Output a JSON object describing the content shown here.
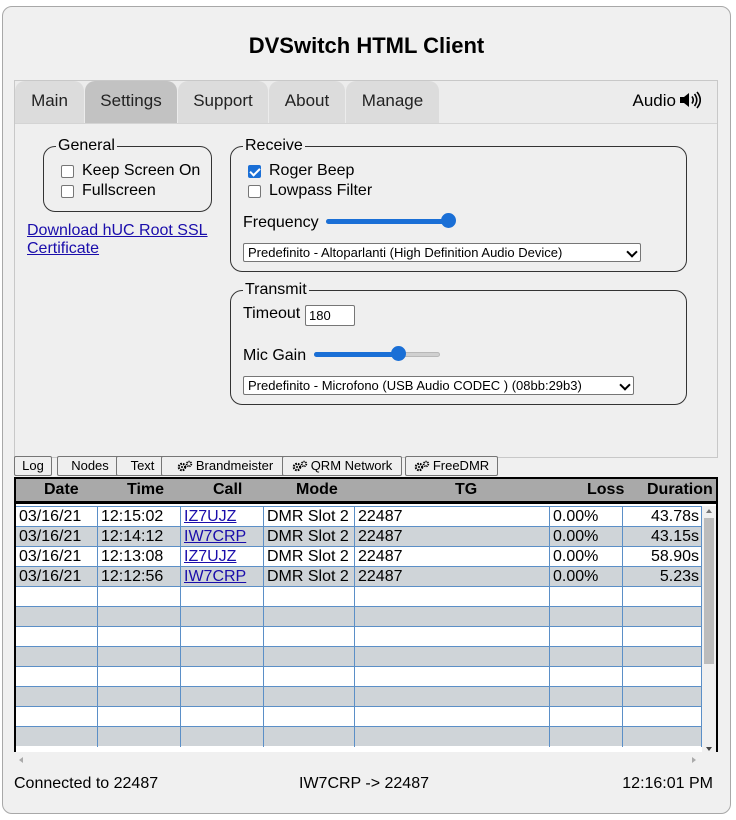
{
  "window": {
    "title": "DVSwitch HTML Client"
  },
  "tabs": [
    {
      "label": "Main",
      "active": false
    },
    {
      "label": "Settings",
      "active": true
    },
    {
      "label": "Support",
      "active": false
    },
    {
      "label": "About",
      "active": false
    },
    {
      "label": "Manage",
      "active": false
    }
  ],
  "audio": {
    "label": "Audio",
    "icon": "speaker-icon"
  },
  "general": {
    "legend": "General",
    "keep_screen_on": {
      "label": "Keep Screen On",
      "checked": false
    },
    "fullscreen": {
      "label": "Fullscreen",
      "checked": false
    }
  },
  "cert_link": "Download hUC Root SSL Certificate",
  "receive": {
    "legend": "Receive",
    "roger_beep": {
      "label": "Roger Beep",
      "checked": true
    },
    "lowpass": {
      "label": "Lowpass Filter",
      "checked": false
    },
    "frequency_label": "Frequency",
    "frequency_level": 1.0,
    "output_device": "Predefinito - Altoparlanti (High Definition Audio Device)"
  },
  "transmit": {
    "legend": "Transmit",
    "timeout_label": "Timeout",
    "timeout_value": "180",
    "mic_gain_label": "Mic Gain",
    "mic_gain_level": 0.68,
    "input_device": "Predefinito - Microfono (USB Audio CODEC ) (08bb:29b3)"
  },
  "log_buttons": [
    {
      "label": "Log",
      "icon": ""
    },
    {
      "label": "Nodes",
      "icon": ""
    },
    {
      "label": "Text",
      "icon": ""
    },
    {
      "label": "Brandmeister",
      "icon": "gears-icon"
    },
    {
      "label": "QRM Network",
      "icon": "gears-icon"
    },
    {
      "label": "FreeDMR",
      "icon": "gears-icon"
    }
  ],
  "table": {
    "columns": [
      "Date",
      "Time",
      "Call",
      "Mode",
      "TG",
      "Loss",
      "Duration"
    ],
    "rows": [
      [
        "03/16/21",
        "12:15:02",
        "IZ7UJZ",
        "DMR Slot 2",
        "22487",
        "0.00%",
        "43.78s"
      ],
      [
        "03/16/21",
        "12:14:12",
        "IW7CRP",
        "DMR Slot 2",
        "22487",
        "0.00%",
        "43.15s"
      ],
      [
        "03/16/21",
        "12:13:08",
        "IZ7UJZ",
        "DMR Slot 2",
        "22487",
        "0.00%",
        "58.90s"
      ],
      [
        "03/16/21",
        "12:12:56",
        "IW7CRP",
        "DMR Slot 2",
        "22487",
        "0.00%",
        "5.23s"
      ]
    ],
    "empty_rows": 8
  },
  "status": {
    "connection": "Connected to 22487",
    "talker": "IW7CRP -> 22487",
    "time": "12:16:01 PM"
  },
  "colors": {
    "accent": "#1a6fd6",
    "link": "#1a0dab",
    "row_alt": "#cfd4d8",
    "grid": "#5b8fc7"
  }
}
